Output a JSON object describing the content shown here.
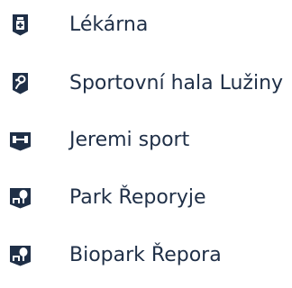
{
  "places": [
    {
      "name": "Lékárna",
      "icon": "pharmacy-icon"
    },
    {
      "name": "Sportovní hala Lužiny",
      "icon": "sports-hall-icon"
    },
    {
      "name": "Jeremi sport",
      "icon": "fitness-dumbbell-icon"
    },
    {
      "name": "Park Řeporyje",
      "icon": "park-icon"
    },
    {
      "name": "Biopark Řepora",
      "icon": "park-icon"
    }
  ],
  "colors": {
    "icon_bg": "#1f2f47",
    "text": "#1f2f47"
  }
}
